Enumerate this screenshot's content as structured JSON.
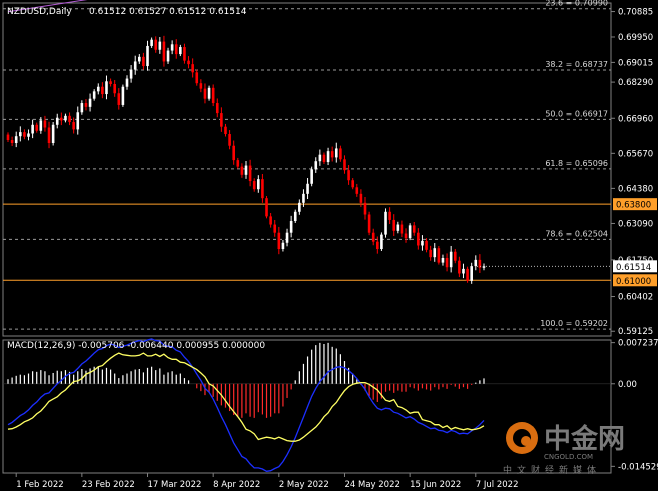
{
  "header": {
    "symbol": "NZDUSD,Daily",
    "ohlc": "0.61512 0.61527 0.61512 0.61514"
  },
  "watermark": {
    "name": "中金网",
    "domain": "CNGOLD.COM",
    "slogan": "中文财经新媒体"
  },
  "colors": {
    "background": "#000000",
    "grid": "#808080",
    "bull": "#ffffff",
    "bear": "#ff0000",
    "price_line": "#ff9f2a",
    "trend_line": "#b45cd6",
    "macd_main": "#1c2fff",
    "macd_signal": "#ffff64",
    "hist_pos": "#ffffff",
    "hist_neg": "#ff2a2a"
  },
  "chart_data": {
    "type": "candlestick",
    "price_axis": {
      "ylim": [
        0.5895,
        0.712
      ],
      "ticks": [
        {
          "value": 0.70885,
          "label": "0.70885"
        },
        {
          "value": 0.6995,
          "label": "0.69950"
        },
        {
          "value": 0.69015,
          "label": "0.69015"
        },
        {
          "value": 0.6829,
          "label": "0.68290"
        },
        {
          "value": 0.6696,
          "label": "0.66960"
        },
        {
          "value": 0.6567,
          "label": "0.65670"
        },
        {
          "value": 0.6438,
          "label": "0.64380"
        },
        {
          "value": 0.6309,
          "label": "0.63090"
        },
        {
          "value": 0.6175,
          "label": "0.61750"
        },
        {
          "value": 0.60402,
          "label": "0.60402"
        },
        {
          "value": 0.59125,
          "label": "0.59125"
        }
      ]
    },
    "fib_levels": [
      {
        "label": "23.6 = 0.70990",
        "value": 0.7099
      },
      {
        "label": "38.2 = 0.68737",
        "value": 0.68737
      },
      {
        "label": "50.0 = 0.66917",
        "value": 0.66917
      },
      {
        "label": "61.8 = 0.65096",
        "value": 0.65096
      },
      {
        "label": "78.6 = 0.62504",
        "value": 0.62504
      },
      {
        "label": "100.0 = 0.59202",
        "value": 0.59202
      }
    ],
    "price_lines": [
      {
        "value": 0.638,
        "label": "0.63800"
      },
      {
        "value": 0.61,
        "label": "0.61000"
      }
    ],
    "current_price": {
      "value": 0.61514,
      "label": "0.61514"
    },
    "x_ticks": [
      {
        "index": 2,
        "label": "1 Feb 2022"
      },
      {
        "index": 18,
        "label": "23 Feb 2022"
      },
      {
        "index": 34,
        "label": "17 Mar 2022"
      },
      {
        "index": 50,
        "label": "8 Apr 2022"
      },
      {
        "index": 66,
        "label": "2 May 2022"
      },
      {
        "index": 82,
        "label": "24 May 2022"
      },
      {
        "index": 98,
        "label": "15 Jun 2022"
      },
      {
        "index": 114,
        "label": "7 Jul 2022"
      }
    ],
    "candle_closes": [
      0.6616,
      0.6605,
      0.663,
      0.6645,
      0.6628,
      0.664,
      0.6672,
      0.665,
      0.6688,
      0.6662,
      0.6605,
      0.6672,
      0.6698,
      0.6688,
      0.6705,
      0.6682,
      0.6655,
      0.6718,
      0.6752,
      0.6738,
      0.6768,
      0.6795,
      0.6812,
      0.6785,
      0.6832,
      0.6822,
      0.6788,
      0.6745,
      0.6812,
      0.6842,
      0.6875,
      0.6905,
      0.6922,
      0.6888,
      0.6962,
      0.6985,
      0.6948,
      0.6978,
      0.6905,
      0.6945,
      0.6968,
      0.6932,
      0.6958,
      0.6908,
      0.6895,
      0.6865,
      0.6825,
      0.6805,
      0.6768,
      0.6808,
      0.6752,
      0.6715,
      0.6665,
      0.6638,
      0.6595,
      0.6542,
      0.6518,
      0.6488,
      0.6522,
      0.6465,
      0.6435,
      0.6472,
      0.6402,
      0.6335,
      0.6305,
      0.6275,
      0.6215,
      0.6238,
      0.6275,
      0.6318,
      0.6352,
      0.6385,
      0.6418,
      0.6455,
      0.6508,
      0.6538,
      0.6562,
      0.6535,
      0.6575,
      0.6552,
      0.6585,
      0.6545,
      0.6505,
      0.6468,
      0.6442,
      0.6418,
      0.6385,
      0.6342,
      0.6275,
      0.6242,
      0.6215,
      0.6268,
      0.6352,
      0.6322,
      0.6282,
      0.6305,
      0.6272,
      0.6255,
      0.6302,
      0.6275,
      0.6228,
      0.6245,
      0.6212,
      0.6185,
      0.6218,
      0.6165,
      0.6182,
      0.6148,
      0.6205,
      0.6172,
      0.6125,
      0.6142,
      0.6098,
      0.6152,
      0.6175,
      0.6146,
      0.61514
    ],
    "trend_line": {
      "start": {
        "index": 0,
        "value": 0.7088
      },
      "end": {
        "index": 72,
        "value": 0.7255
      }
    },
    "macd": {
      "params": "12,26,9",
      "ylim": [
        -0.0157,
        0.0077
      ],
      "ticks": [
        {
          "value": 0.007237,
          "label": "0.007237"
        },
        {
          "value": 0.0,
          "label": "0.00"
        },
        {
          "value": -0.014529,
          "label": "-0.014529"
        }
      ],
      "histogram": [
        0.0008,
        0.0011,
        0.0014,
        0.0016,
        0.0015,
        0.0018,
        0.0022,
        0.0021,
        0.0024,
        0.0022,
        0.0015,
        0.0019,
        0.0023,
        0.0022,
        0.0024,
        0.0021,
        0.0016,
        0.0022,
        0.0026,
        0.0023,
        0.0027,
        0.003,
        0.003,
        0.0025,
        0.0028,
        0.0025,
        0.0018,
        0.001,
        0.0015,
        0.0018,
        0.0022,
        0.0025,
        0.0026,
        0.002,
        0.0028,
        0.003,
        0.0024,
        0.0027,
        0.0016,
        0.002,
        0.0022,
        0.0016,
        0.0018,
        0.001,
        0.0006,
        0.0,
        -0.0008,
        -0.0013,
        -0.002,
        -0.0015,
        -0.0023,
        -0.003,
        -0.0038,
        -0.0042,
        -0.0048,
        -0.0055,
        -0.0058,
        -0.006,
        -0.0052,
        -0.0058,
        -0.006,
        -0.005,
        -0.0054,
        -0.006,
        -0.0058,
        -0.0052,
        -0.0052,
        -0.004,
        -0.0025,
        -0.001,
        0.0006,
        0.0022,
        0.0035,
        0.0048,
        0.006,
        0.0068,
        0.0072,
        0.007,
        0.0072,
        0.0065,
        0.0062,
        0.0052,
        0.004,
        0.0028,
        0.0018,
        0.0008,
        -0.0002,
        -0.0012,
        -0.0022,
        -0.0028,
        -0.0032,
        -0.0026,
        -0.0014,
        -0.0012,
        -0.0016,
        -0.0012,
        -0.0014,
        -0.0014,
        -0.0006,
        -0.0008,
        -0.0012,
        -0.0008,
        -0.001,
        -0.0012,
        -0.0006,
        -0.001,
        -0.0006,
        -0.0009,
        -0.0002,
        -0.0005,
        -0.0009,
        -0.0006,
        -0.0009,
        -0.0002,
        0.0002,
        0.0006,
        0.00095
      ],
      "macd_line": [
        -0.0072,
        -0.0068,
        -0.0062,
        -0.0056,
        -0.0052,
        -0.0046,
        -0.0038,
        -0.0032,
        -0.0024,
        -0.0018,
        -0.0016,
        -0.0008,
        0.0,
        0.0006,
        0.0013,
        0.0018,
        0.002,
        0.0027,
        0.0035,
        0.004,
        0.0047,
        0.0054,
        0.006,
        0.0062,
        0.0067,
        0.007,
        0.0068,
        0.0064,
        0.0066,
        0.0068,
        0.0071,
        0.0074,
        0.0076,
        0.0074,
        0.0077,
        0.0079,
        0.0076,
        0.0075,
        0.0068,
        0.0066,
        0.0065,
        0.0059,
        0.0056,
        0.0047,
        0.0039,
        0.0029,
        0.0017,
        0.0006,
        -0.0008,
        -0.0015,
        -0.0027,
        -0.0042,
        -0.0058,
        -0.0072,
        -0.0088,
        -0.0104,
        -0.0116,
        -0.0128,
        -0.0132,
        -0.0141,
        -0.0148,
        -0.0148,
        -0.015,
        -0.0154,
        -0.0153,
        -0.0149,
        -0.0146,
        -0.0137,
        -0.0125,
        -0.0111,
        -0.0095,
        -0.0077,
        -0.0059,
        -0.004,
        -0.0022,
        -0.0008,
        0.0004,
        0.0012,
        0.0021,
        0.0025,
        0.0029,
        0.003,
        0.0028,
        0.0023,
        0.0017,
        0.0009,
        0.0,
        -0.001,
        -0.0023,
        -0.0034,
        -0.0043,
        -0.0046,
        -0.0043,
        -0.0044,
        -0.005,
        -0.0052,
        -0.0056,
        -0.006,
        -0.0058,
        -0.0062,
        -0.0068,
        -0.0071,
        -0.0075,
        -0.0079,
        -0.0078,
        -0.0082,
        -0.0083,
        -0.0086,
        -0.0082,
        -0.0084,
        -0.0088,
        -0.0087,
        -0.0088,
        -0.0083,
        -0.0078,
        -0.0072,
        -0.00644
      ],
      "signal_line": [
        -0.008,
        -0.0079,
        -0.0076,
        -0.0072,
        -0.0067,
        -0.0064,
        -0.006,
        -0.0053,
        -0.0048,
        -0.004,
        -0.0031,
        -0.0027,
        -0.0023,
        -0.0016,
        -0.0011,
        -0.0003,
        0.0004,
        0.0005,
        0.0009,
        0.0017,
        0.002,
        0.0024,
        0.003,
        0.0032,
        0.0039,
        0.0045,
        0.005,
        0.0054,
        0.0051,
        0.005,
        0.0049,
        0.0049,
        0.005,
        0.0054,
        0.0049,
        0.0049,
        0.0052,
        0.0048,
        0.0052,
        0.0046,
        0.0043,
        0.0043,
        0.0038,
        0.0037,
        0.0033,
        0.0029,
        0.0025,
        0.0019,
        0.0012,
        0.0,
        -0.0004,
        -0.0012,
        -0.002,
        -0.003,
        -0.004,
        -0.0049,
        -0.0058,
        -0.0068,
        -0.008,
        -0.0083,
        -0.0088,
        -0.0098,
        -0.0096,
        -0.0094,
        -0.0095,
        -0.0097,
        -0.0094,
        -0.0097,
        -0.01,
        -0.0101,
        -0.0101,
        -0.0099,
        -0.0094,
        -0.0088,
        -0.0082,
        -0.0076,
        -0.0068,
        -0.0058,
        -0.0051,
        -0.004,
        -0.0033,
        -0.0022,
        -0.0012,
        -0.0005,
        -0.0001,
        0.0001,
        0.0002,
        0.0002,
        -0.0001,
        -0.0006,
        -0.0011,
        -0.002,
        -0.0029,
        -0.0031,
        -0.0028,
        -0.004,
        -0.0042,
        -0.0046,
        -0.0052,
        -0.005,
        -0.005,
        -0.0063,
        -0.0065,
        -0.0067,
        -0.0072,
        -0.0072,
        -0.0077,
        -0.0074,
        -0.008,
        -0.0077,
        -0.0079,
        -0.0081,
        -0.0079,
        -0.0081,
        -0.008,
        -0.0078,
        -0.0074
      ]
    }
  }
}
